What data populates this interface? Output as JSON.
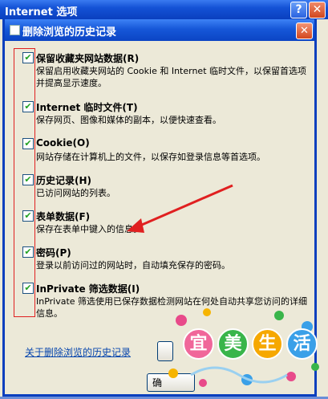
{
  "outer_window": {
    "title": "Internet 选项",
    "help": "?",
    "close": "✕"
  },
  "dialog": {
    "title": "删除浏览的历史记录",
    "close": "✕",
    "options": [
      {
        "label": "保留收藏夹网站数据(R)",
        "desc": "保留启用收藏夹网站的 Cookie 和 Internet 临时文件，以保留首选项并提高显示速度。",
        "checked": true
      },
      {
        "label": "Internet 临时文件(T)",
        "desc": "保存网页、图像和媒体的副本，以便快速查看。",
        "checked": true
      },
      {
        "label": "Cookie(O)",
        "desc": "网站存储在计算机上的文件，以保存如登录信息等首选项。",
        "checked": true
      },
      {
        "label": "历史记录(H)",
        "desc": "已访问网站的列表。",
        "checked": true
      },
      {
        "label": "表单数据(F)",
        "desc": "保存在表单中键入的信息。",
        "checked": true
      },
      {
        "label": "密码(P)",
        "desc": "登录以前访问过的网站时，自动填充保存的密码。",
        "checked": true
      },
      {
        "label": "InPrivate 筛选数据(I)",
        "desc": "InPrivate 筛选使用已保存数据检测网站在何处自动共享您访问的详细信息。",
        "checked": true
      }
    ],
    "about_link": "关于删除浏览的历史记录",
    "button_partial": "确"
  },
  "watermark": {
    "chars": [
      "宜",
      "美",
      "生",
      "活"
    ]
  },
  "colors": {
    "annotation": "#e02020",
    "title_bar": "#1657d8"
  }
}
